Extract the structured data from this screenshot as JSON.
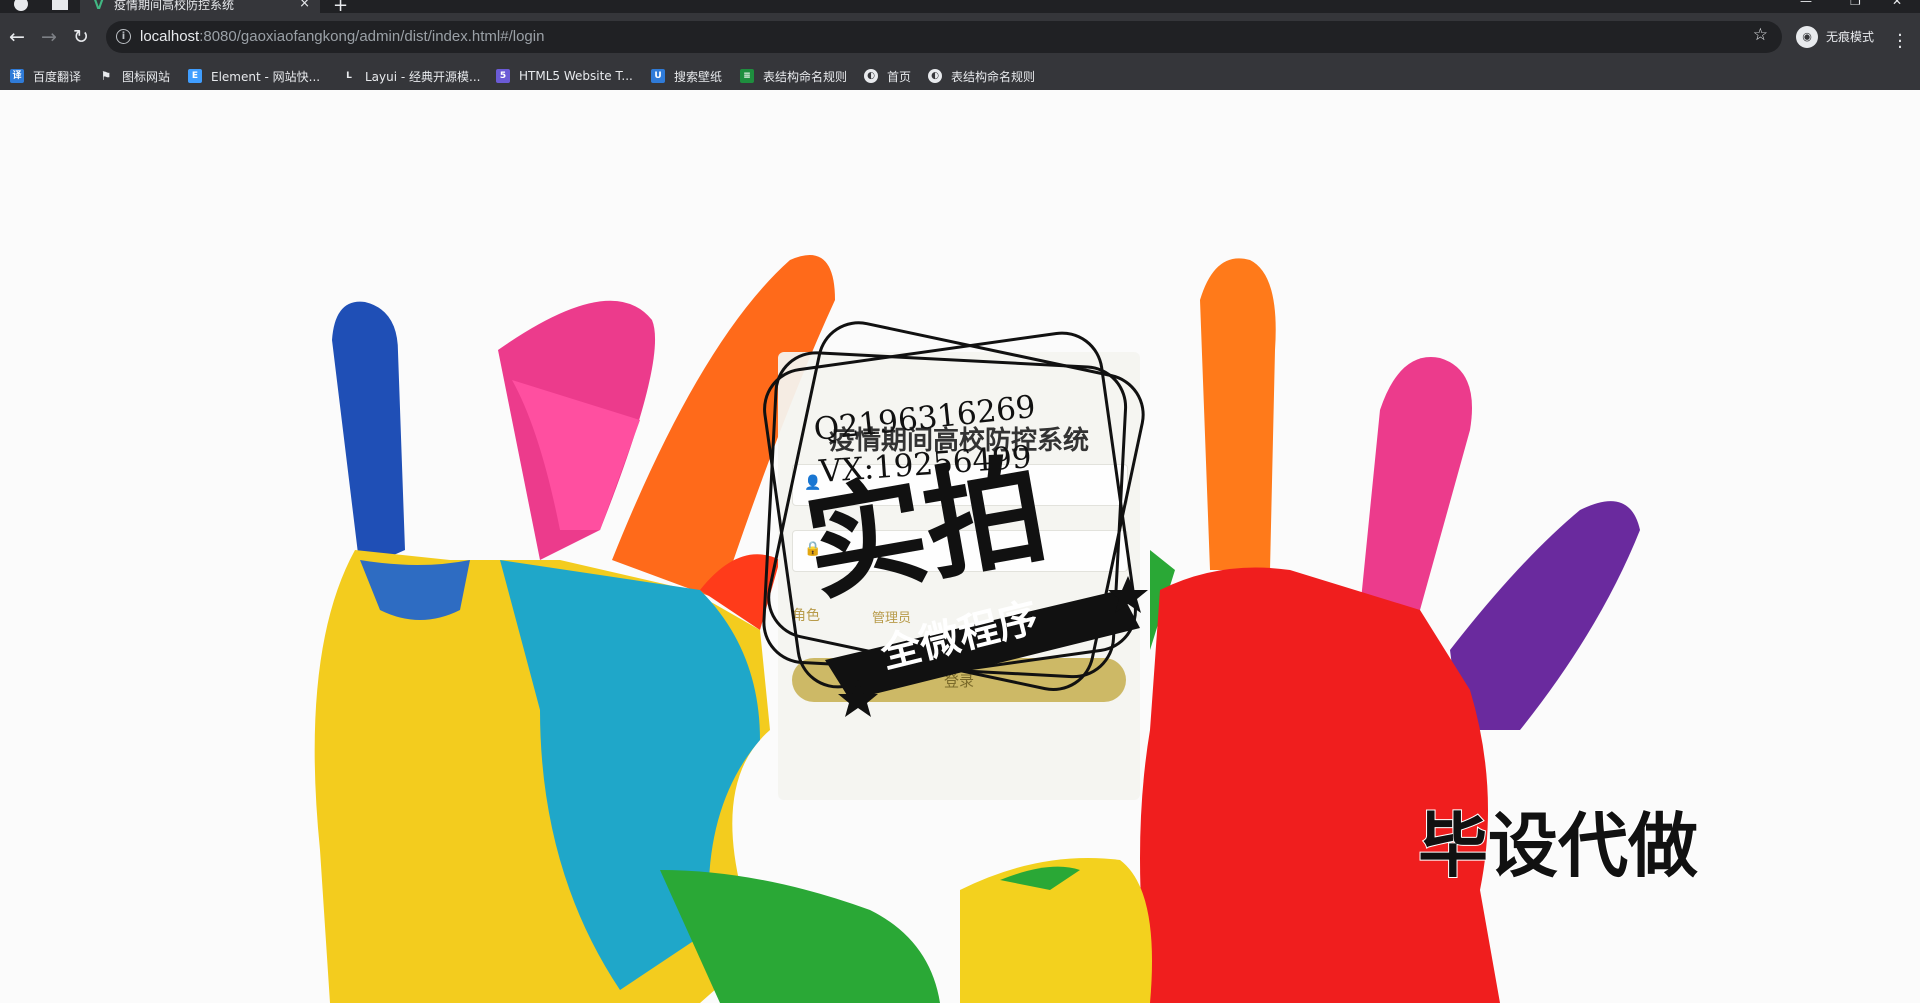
{
  "browser": {
    "tab_title": "疫情期间高校防控系统",
    "tab_close": "×",
    "new_tab": "+",
    "url_host": "localhost",
    "url_rest": ":8080/gaoxiaofangkong/admin/dist/index.html#/login",
    "incognito_label": "无痕模式"
  },
  "bookmarks": [
    {
      "label": "百度翻译",
      "icon": "translate-icon",
      "color": "#2f7bd8"
    },
    {
      "label": "图标网站",
      "icon": "flag-icon",
      "color": "#35363a"
    },
    {
      "label": "Element - 网站快...",
      "icon": "element-icon",
      "color": "#409eff"
    },
    {
      "label": "Layui - 经典开源模...",
      "icon": "layui-icon",
      "color": "#35363a"
    },
    {
      "label": "HTML5 Website T...",
      "icon": "html5-icon",
      "color": "#6b5bd6"
    },
    {
      "label": "搜索壁纸",
      "icon": "wallpaper-icon",
      "color": "#2f7bd8"
    },
    {
      "label": "表结构命名规则",
      "icon": "sheet-icon",
      "color": "#1e8e3e"
    },
    {
      "label": "首页",
      "icon": "globe-icon",
      "color": "#35363a"
    },
    {
      "label": "表结构命名规则",
      "icon": "globe-icon",
      "color": "#35363a"
    }
  ],
  "login": {
    "title": "疫情期间高校防控系统",
    "username_value": "",
    "password_value": "",
    "role_label": "角色",
    "role_value": "管理员",
    "submit_label": "登录"
  },
  "overlays": {
    "stamp_qq": "Q2196316269",
    "stamp_vx": "VX:19256499",
    "stamp_big": "实拍",
    "stamp_ribbon": "全微程序",
    "watermark": "毕设代做"
  },
  "colors": {
    "accent": "#cdb966",
    "chrome_dark": "#202124",
    "chrome": "#35363a"
  }
}
